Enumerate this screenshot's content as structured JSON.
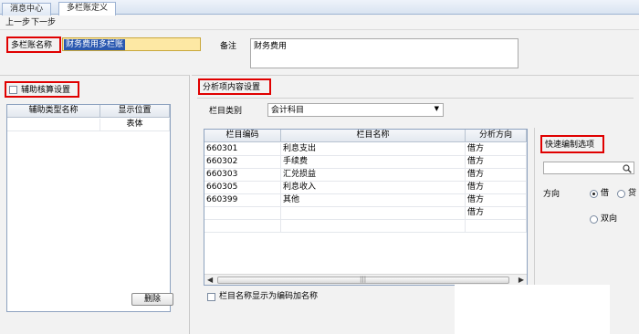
{
  "tabs": [
    {
      "label": "消息中心"
    },
    {
      "label": "多栏账定义"
    }
  ],
  "toolbar": {
    "prev": "上一步",
    "next": "下一步"
  },
  "header": {
    "name_label": "多栏账名称",
    "name_value": "财务费用多栏账",
    "remark_label": "备注",
    "remark_value": "财务费用"
  },
  "left": {
    "aux_check_label": "辅助核算设置",
    "columns": [
      "辅助类型名称",
      "显示位置"
    ],
    "rows": [
      [
        "",
        "表体"
      ]
    ],
    "delete_label": "删除"
  },
  "right": {
    "section_title": "分析项内容设置",
    "category_label": "栏目类别",
    "category_value": "会计科目",
    "columns": [
      "栏目编码",
      "栏目名称",
      "分析方向"
    ],
    "rows": [
      [
        "660301",
        "利息支出",
        "借方"
      ],
      [
        "660302",
        "手续费",
        "借方"
      ],
      [
        "660303",
        "汇兑损益",
        "借方"
      ],
      [
        "660305",
        "利息收入",
        "借方"
      ],
      [
        "660399",
        "其他",
        "借方"
      ],
      [
        "",
        "",
        "借方"
      ]
    ],
    "show_code_label": "栏目名称显示为编码加名称",
    "quick": {
      "title": "快速编制选项",
      "direction_label": "方向",
      "debit": "借",
      "credit": "贷",
      "both": "双向",
      "selected": "借"
    }
  }
}
